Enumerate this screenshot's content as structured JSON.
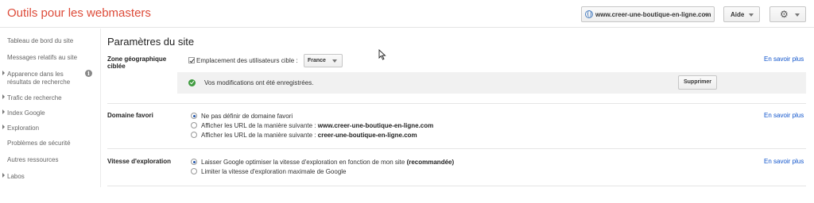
{
  "header": {
    "app_title": "Outils pour les webmasters",
    "site_selector": "www.creer-une-boutique-en-ligne.com",
    "help_label": "Aide",
    "settings_icon": "gear-icon"
  },
  "sidebar": {
    "items": [
      {
        "label": "Tableau de bord du site",
        "expandable": false
      },
      {
        "label": "Messages relatifs au site",
        "expandable": false
      },
      {
        "label_line1": "Apparence dans les",
        "label_line2": "résultats de recherche",
        "expandable": true
      },
      {
        "label": "Trafic de recherche",
        "expandable": true
      },
      {
        "label": "Index Google",
        "expandable": true
      },
      {
        "label": "Exploration",
        "expandable": true
      },
      {
        "label": "Problèmes de sécurité",
        "expandable": false
      },
      {
        "label": "Autres ressources",
        "expandable": false
      },
      {
        "label": "Labos",
        "expandable": true
      }
    ],
    "info_icon": "i"
  },
  "main": {
    "page_title": "Paramètres du site",
    "learn_more": "En savoir plus",
    "geo": {
      "label_line1": "Zone géographique",
      "label_line2": "ciblée",
      "checkbox_label": "Emplacement des utilisateurs cible :",
      "checked": true,
      "country": "France",
      "notice": "Vos modifications ont été enregistrées.",
      "delete_label": "Supprimer"
    },
    "domain": {
      "label": "Domaine favori",
      "options": [
        {
          "text": "Ne pas définir de domaine favori",
          "bold": "",
          "selected": true
        },
        {
          "text": "Afficher les URL de la manière suivante : ",
          "bold": "www.creer-une-boutique-en-ligne.com",
          "selected": false
        },
        {
          "text": "Afficher les URL de la manière suivante : ",
          "bold": "creer-une-boutique-en-ligne.com",
          "selected": false
        }
      ]
    },
    "crawl": {
      "label": "Vitesse d'exploration",
      "options": [
        {
          "text": "Laisser Google optimiser la vitesse d'exploration en fonction de mon site ",
          "bold": "(recommandée)",
          "selected": true
        },
        {
          "text": "Limiter la vitesse d'exploration maximale de Google",
          "bold": "",
          "selected": false
        }
      ]
    }
  },
  "colors": {
    "title_red": "#dd4b39",
    "link_blue": "#1155cc",
    "success_green": "#3f9b3f",
    "notice_bg": "#f1f1f1"
  }
}
